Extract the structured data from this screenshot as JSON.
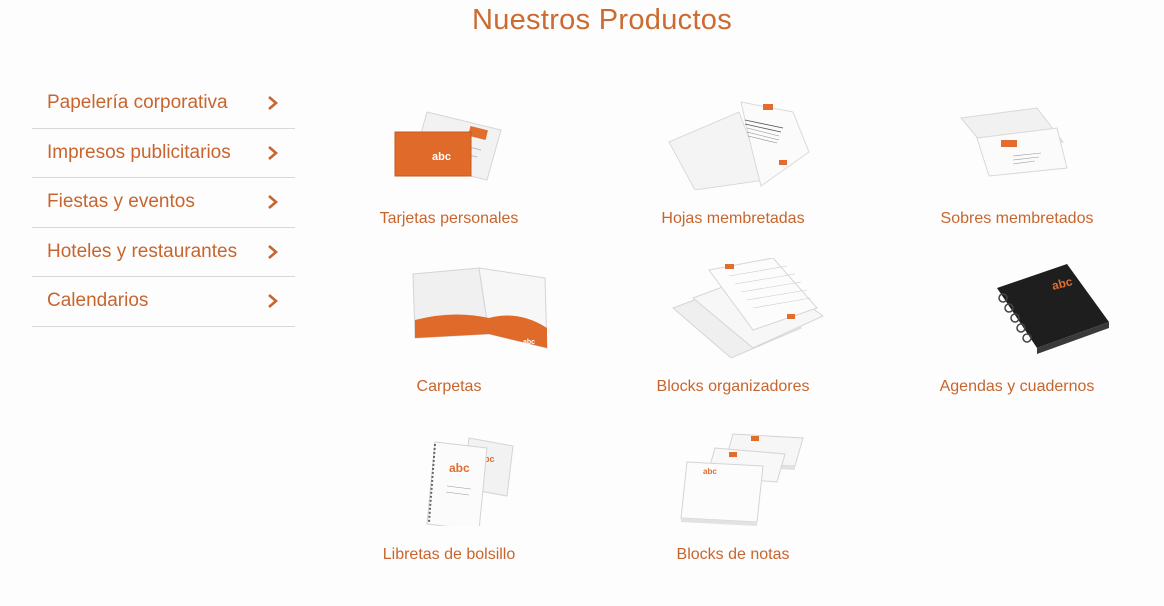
{
  "page_title": "Nuestros Productos",
  "sidebar": {
    "items": [
      {
        "label": "Papelería corporativa"
      },
      {
        "label": "Impresos publicitarios"
      },
      {
        "label": "Fiestas y eventos"
      },
      {
        "label": "Hoteles y restaurantes"
      },
      {
        "label": "Calendarios"
      }
    ]
  },
  "products": [
    {
      "label": "Tarjetas personales",
      "icon": "business-cards-icon"
    },
    {
      "label": "Hojas membretadas",
      "icon": "letterhead-icon"
    },
    {
      "label": "Sobres membretados",
      "icon": "envelope-icon"
    },
    {
      "label": "Carpetas",
      "icon": "folder-icon"
    },
    {
      "label": "Blocks organizadores",
      "icon": "organizer-block-icon"
    },
    {
      "label": "Agendas y cuadernos",
      "icon": "planner-icon"
    },
    {
      "label": "Libretas de bolsillo",
      "icon": "pocket-notebook-icon"
    },
    {
      "label": "Blocks de notas",
      "icon": "notepad-icon"
    }
  ],
  "colors": {
    "accent": "#cc6a2f",
    "text": "#c8652e",
    "divider": "#d8d8d8"
  }
}
